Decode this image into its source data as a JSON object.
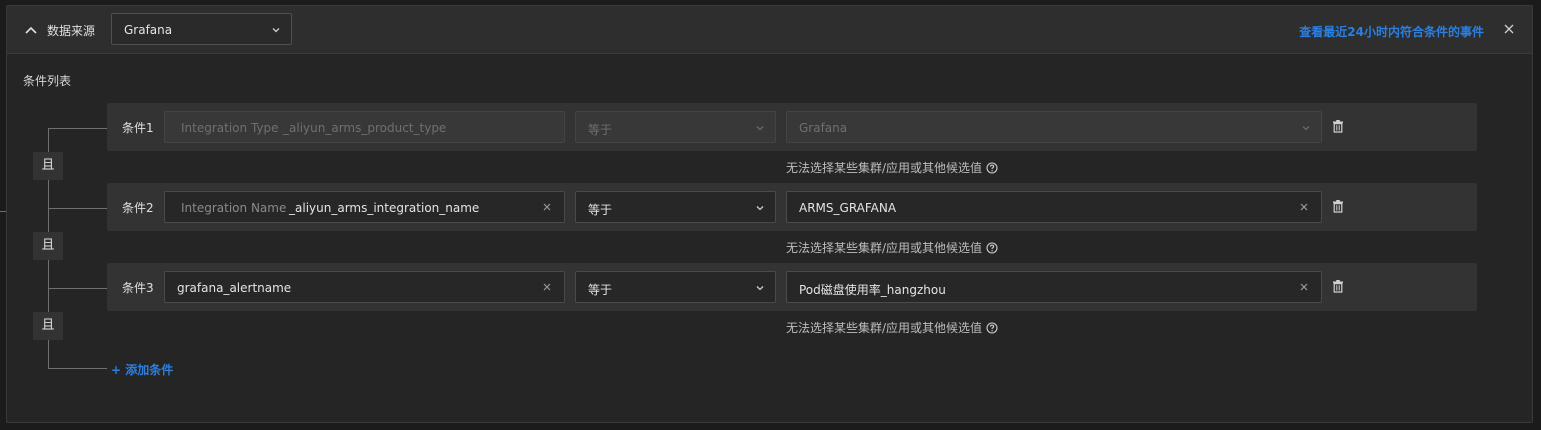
{
  "header": {
    "label": "数据来源",
    "source_value": "Grafana",
    "link_text": "查看最近24小时内符合条件的事件",
    "collapse_icon": "chevron-up-icon",
    "close_icon": "close-icon"
  },
  "list_title": "条件列表",
  "logic_label": "且",
  "conditions": [
    {
      "label": "条件1",
      "key_name": "Integration Type",
      "key_value": "_aliyun_arms_product_type",
      "operator": "等于",
      "value": "Grafana",
      "disabled": true,
      "hint": "无法选择某些集群/应用或其他候选值"
    },
    {
      "label": "条件2",
      "key_name": "Integration Name",
      "key_value": "_aliyun_arms_integration_name",
      "operator": "等于",
      "value": "ARMS_GRAFANA",
      "disabled": false,
      "hint": "无法选择某些集群/应用或其他候选值"
    },
    {
      "label": "条件3",
      "key_name": "",
      "key_value": "grafana_alertname",
      "operator": "等于",
      "value": "Pod磁盘使用率_hangzhou",
      "disabled": false,
      "hint": "无法选择某些集群/应用或其他候选值"
    }
  ],
  "add_condition": "+ 添加条件",
  "colors": {
    "accent": "#2b7fe0",
    "panel": "#252525",
    "row": "#333333"
  }
}
